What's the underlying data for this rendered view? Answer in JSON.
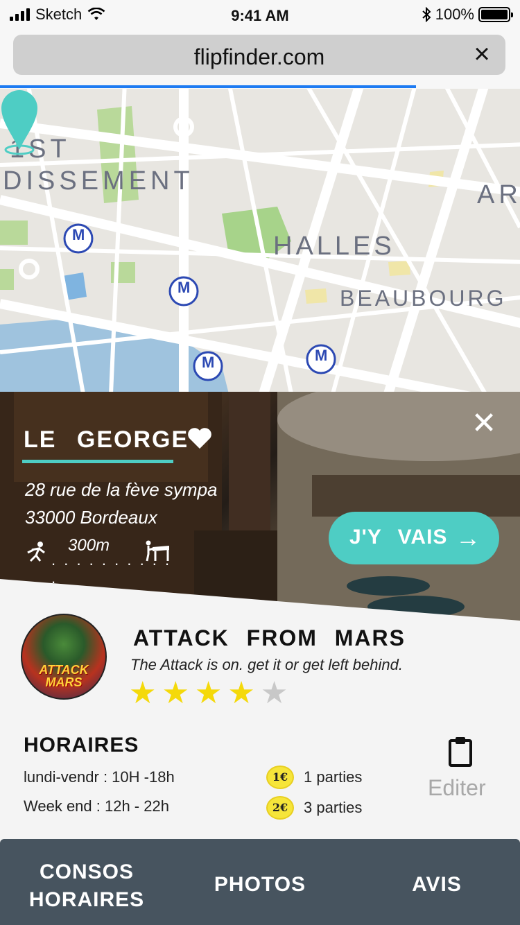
{
  "status_bar": {
    "carrier": "Sketch",
    "time": "9:41 AM",
    "battery": "100%"
  },
  "browser": {
    "url": "flipfinder.com",
    "close_icon": "close-icon",
    "load_progress": 0.8
  },
  "map": {
    "labels": [
      "1ST",
      "DISSEMENT",
      "HALLES",
      "BEAUBOURG",
      "AR"
    ],
    "metro_symbol": "M",
    "pin_color": "#4ecdc4"
  },
  "venue": {
    "name": "LE GEORGE",
    "favorite_icon": "heart-icon",
    "address_line1": "28 rue de la fève sympa",
    "address_line2": "33000 Bordeaux",
    "distance": "300m",
    "dots": ". . . . . . . . . . .",
    "go_button": "J'Y VAIS",
    "go_arrow": "→",
    "close": "✕"
  },
  "game": {
    "title": "ATTACK FROM MARS",
    "subtitle": "The Attack is on. get it or get left behind.",
    "rating": 4,
    "rating_max": 5,
    "thumbnail_text": "ATTACK MARS"
  },
  "horaires": {
    "title": "HORAIRES",
    "weekday": "lundi-vendr : 10H -18h",
    "weekend": "Week end :  12h - 22h"
  },
  "prices": [
    {
      "coin": "1€",
      "label": "1 parties"
    },
    {
      "coin": "2€",
      "label": "3 parties"
    }
  ],
  "edit_label": "Editer",
  "tabs": [
    {
      "label": "CONSOS HORAIRES"
    },
    {
      "label": "PHOTOS"
    },
    {
      "label": "AVIS"
    }
  ],
  "colors": {
    "accent": "#4ecdc4",
    "tabbar": "#47545f",
    "star": "#f4d90a",
    "progress": "#1e7bf2"
  }
}
